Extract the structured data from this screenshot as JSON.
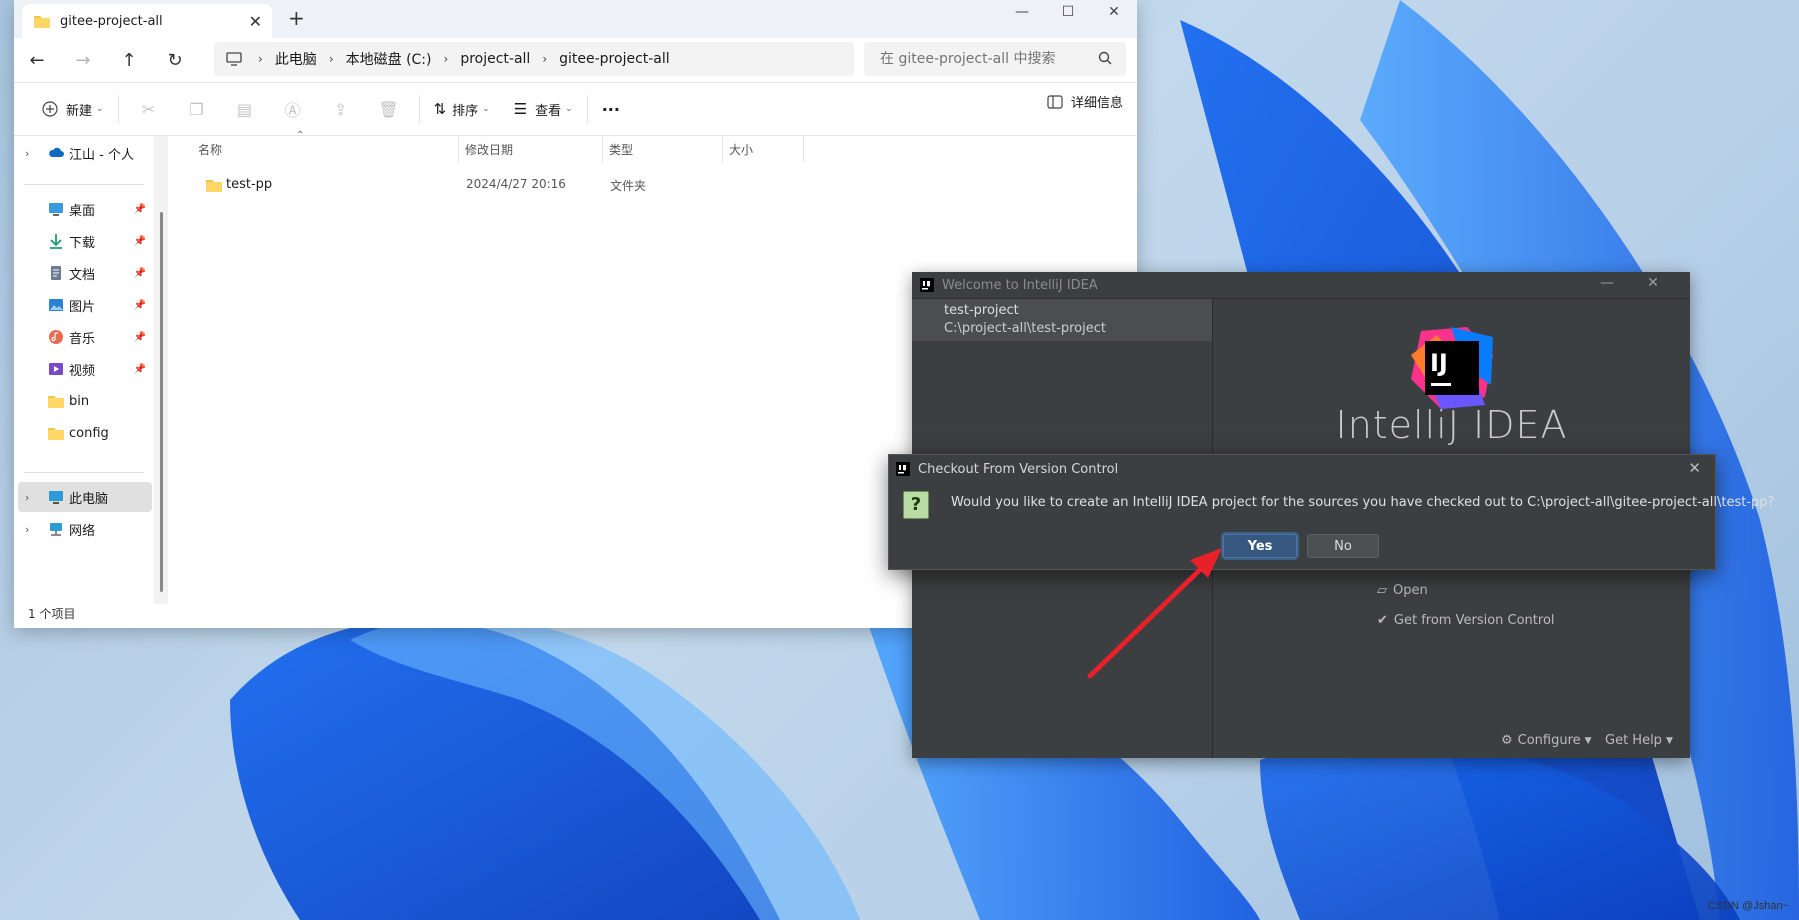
{
  "colors": {
    "accent": "#365880",
    "arrow": "#e8202a",
    "ij_bg": "#3c3f41",
    "explorer_bg": "#ffffff"
  },
  "explorer": {
    "tab_title": "gitee-project-all",
    "new_tab": "+",
    "window_controls": {
      "minimize": "—",
      "maximize": "☐",
      "close": "✕"
    },
    "breadcrumb": [
      "此电脑",
      "本地磁盘 (C:)",
      "project-all",
      "gitee-project-all"
    ],
    "search_placeholder": "在 gitee-project-all 中搜索",
    "toolbar": {
      "new_label": "新建",
      "sort_label": "排序",
      "view_label": "查看",
      "more_label": "···",
      "details_label": "详细信息"
    },
    "sidebar": {
      "cloud": "江山 - 个人",
      "quick": [
        {
          "label": "桌面",
          "icon": "desktop-icon",
          "pinned": true
        },
        {
          "label": "下载",
          "icon": "download-icon",
          "pinned": true
        },
        {
          "label": "文档",
          "icon": "document-icon",
          "pinned": true
        },
        {
          "label": "图片",
          "icon": "picture-icon",
          "pinned": true
        },
        {
          "label": "音乐",
          "icon": "music-icon",
          "pinned": true
        },
        {
          "label": "视频",
          "icon": "video-icon",
          "pinned": true
        },
        {
          "label": "bin",
          "icon": "folder-icon",
          "pinned": false
        },
        {
          "label": "config",
          "icon": "folder-icon",
          "pinned": false
        }
      ],
      "this_pc": "此电脑",
      "network": "网络"
    },
    "columns": {
      "name": "名称",
      "modified": "修改日期",
      "type": "类型",
      "size": "大小"
    },
    "files": [
      {
        "name": "test-pp",
        "modified": "2024/4/27 20:16",
        "type": "文件夹",
        "size": ""
      }
    ],
    "status": "1 个项目"
  },
  "intellij": {
    "window_title": "Welcome to IntelliJ IDEA",
    "recent": {
      "name": "test-project",
      "path": "C:\\project-all\\test-project"
    },
    "logo_text": "IJ",
    "product_name": "IntelliJ IDEA",
    "actions": {
      "open": "Open",
      "get_vcs": "Get from Version Control"
    },
    "footer": {
      "configure": "Configure",
      "help": "Get Help"
    }
  },
  "dialog": {
    "title": "Checkout From Version Control",
    "icon": "question-icon",
    "question_mark": "?",
    "message": "Would you like to create an IntelliJ IDEA project for the sources you have checked out to C:\\project-all\\gitee-project-all\\test-pp?",
    "yes_label": "Yes",
    "no_label": "No",
    "close": "✕"
  },
  "watermark": "CSDN @Jshan~"
}
